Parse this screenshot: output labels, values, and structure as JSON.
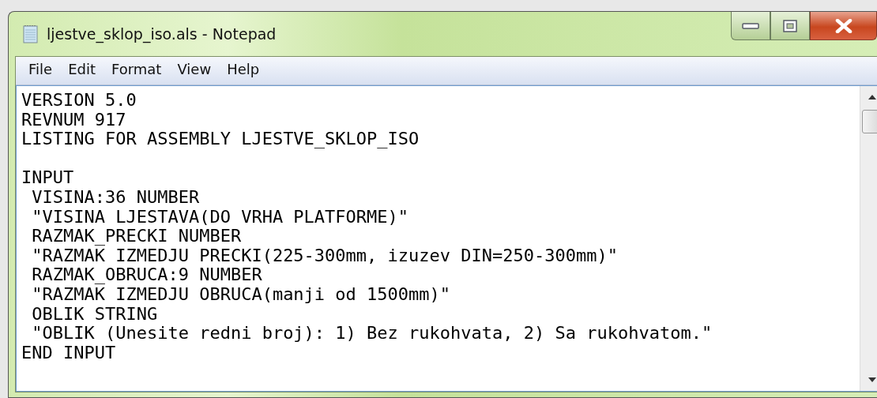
{
  "window": {
    "title": "ljestve_sklop_iso.als - Notepad"
  },
  "menu": [
    {
      "label": "File"
    },
    {
      "label": "Edit"
    },
    {
      "label": "Format"
    },
    {
      "label": "View"
    },
    {
      "label": "Help"
    }
  ],
  "document": {
    "paragraphs": [
      [
        "VERSION 5.0",
        "REVNUM 917",
        "LISTING FOR ASSEMBLY LJESTVE_SKLOP_ISO"
      ],
      [
        "INPUT",
        " VISINA:36 NUMBER",
        " \"VISINA LJESTAVA(DO VRHA PLATFORME)\"",
        " RAZMAK_PRECKI NUMBER",
        " \"RAZMAK IZMEDJU PRECKI(225-300mm, izuzev DIN=250-300mm)\"",
        " RAZMAK_OBRUCA:9 NUMBER",
        " \"RAZMAK IZMEDJU OBRUCA(manji od 1500mm)\"",
        " OBLIK STRING",
        " \"OBLIK (Unesite redni broj): 1) Bez rukohvata, 2) Sa rukohvatom.\"",
        "END INPUT"
      ]
    ]
  }
}
